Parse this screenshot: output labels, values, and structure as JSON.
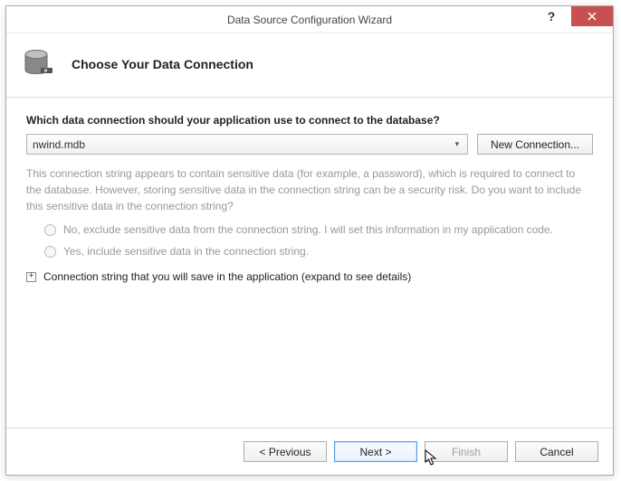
{
  "window": {
    "title": "Data Source Configuration Wizard"
  },
  "header": {
    "title": "Choose Your Data Connection"
  },
  "content": {
    "question": "Which data connection should your application use to connect to the database?",
    "selected_connection": "nwind.mdb",
    "new_connection_label": "New Connection...",
    "sensitive_info": "This connection string appears to contain sensitive data (for example, a password), which is required to connect to the database. However, storing sensitive data in the connection string can be a security risk. Do you want to include this sensitive data in the connection string?",
    "radio_no": "No, exclude sensitive data from the connection string. I will set this information in my application code.",
    "radio_yes": "Yes, include sensitive data in the connection string.",
    "expander_label": "Connection string that you will save in the application (expand to see details)"
  },
  "footer": {
    "previous": "< Previous",
    "next": "Next >",
    "finish": "Finish",
    "cancel": "Cancel"
  }
}
